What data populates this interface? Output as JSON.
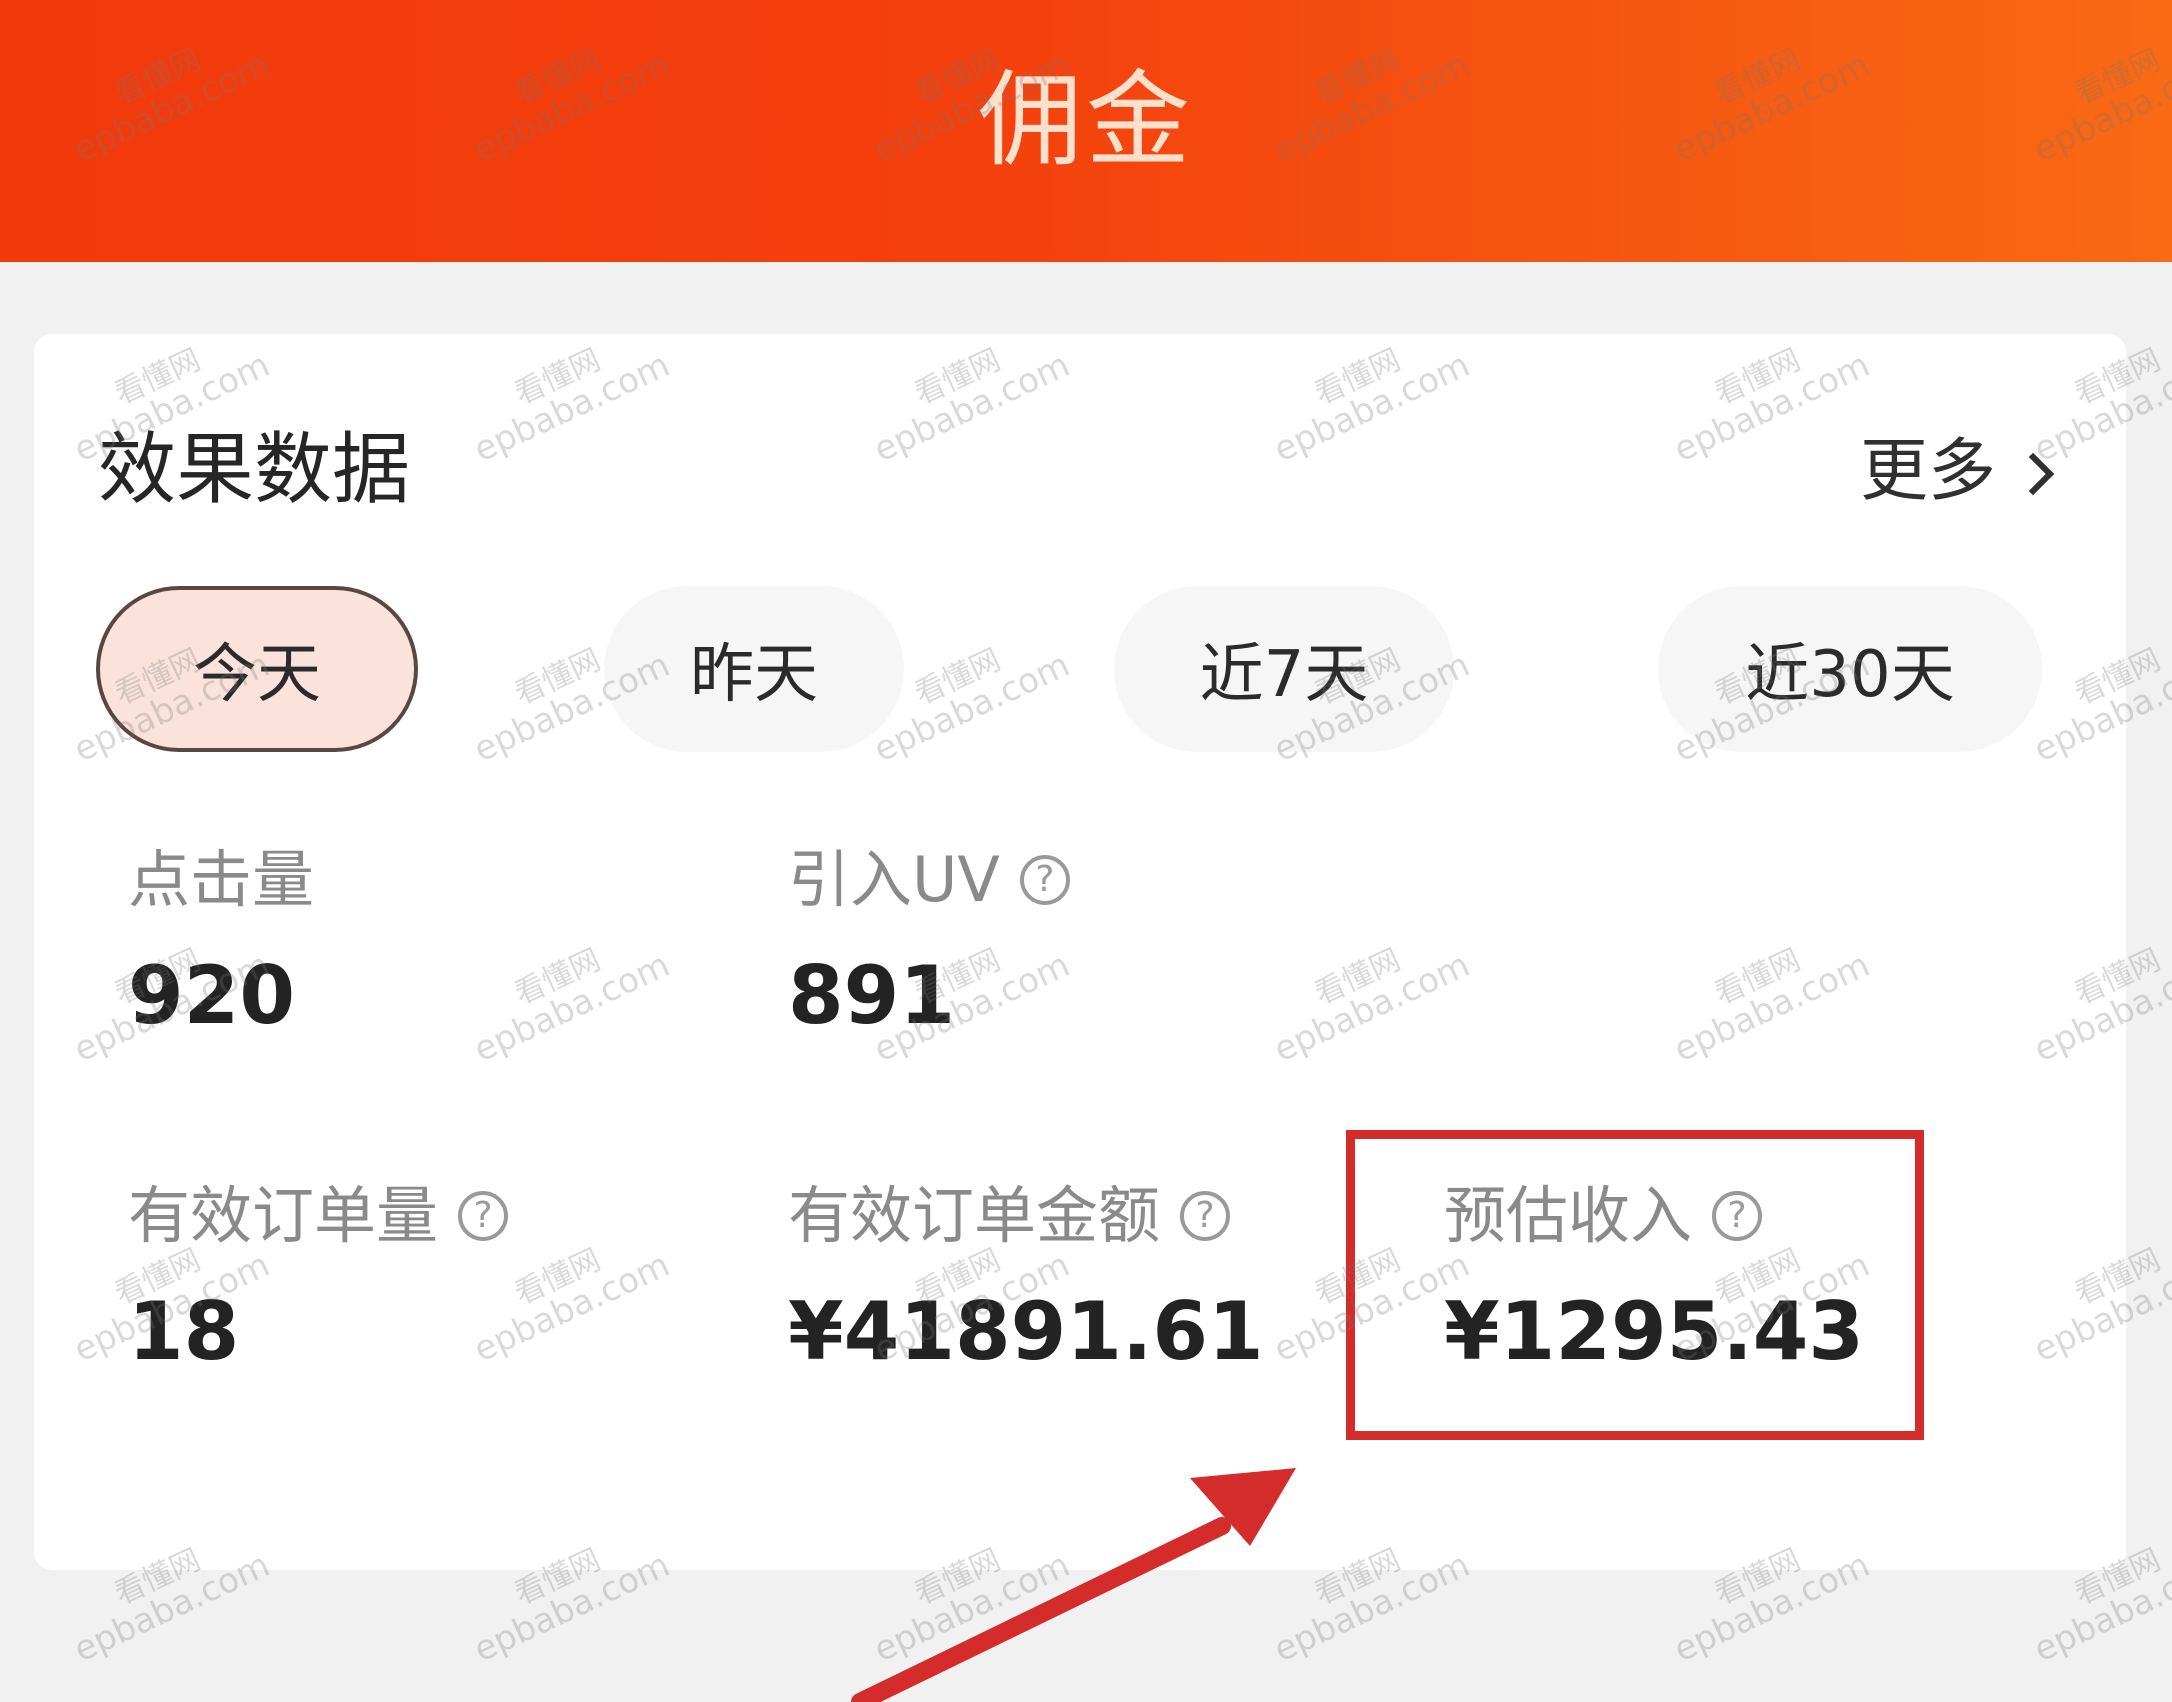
{
  "header": {
    "title": "佣金"
  },
  "card": {
    "title": "效果数据",
    "more_label": "更多"
  },
  "tabs": [
    {
      "label": "今天",
      "active": true
    },
    {
      "label": "昨天",
      "active": false
    },
    {
      "label": "近7天",
      "active": false
    },
    {
      "label": "近30天",
      "active": false
    }
  ],
  "metrics": {
    "clicks": {
      "label": "点击量",
      "value": "920"
    },
    "uv": {
      "label": "引入UV",
      "value": "891"
    },
    "valid_orders": {
      "label": "有效订单量",
      "value": "18"
    },
    "valid_order_amount": {
      "label": "有效订单金额",
      "value": "¥41891.61"
    },
    "estimated_income": {
      "label": "预估收入",
      "value": "¥1295.43"
    }
  },
  "icons": {
    "more": "chevron-right-icon",
    "help": "help-circle-icon"
  },
  "help_glyph": "?",
  "watermark": {
    "line1": "看懂网",
    "line2": "epbaba.com"
  },
  "colors": {
    "header_start": "#f13a0c",
    "header_end": "#f86a14",
    "active_tab_bg": "#fbe3dc",
    "annotation": "#d42b2b"
  }
}
